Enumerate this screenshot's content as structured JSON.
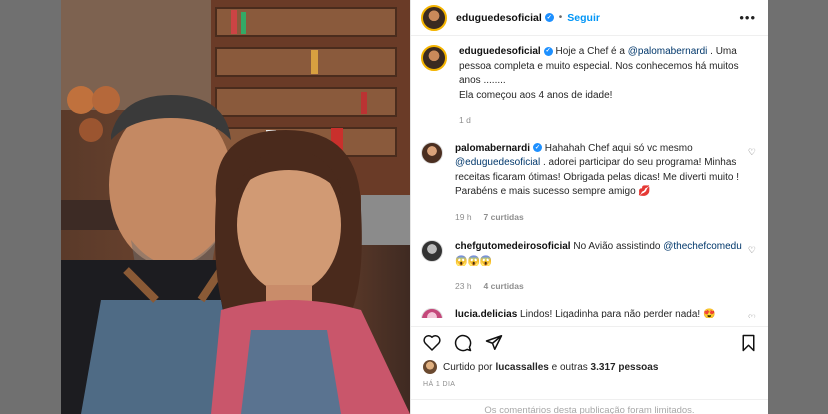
{
  "post": {
    "author": "eduguedesoficial",
    "follow_label": "Seguir",
    "separator": "•",
    "more_label": "•••"
  },
  "caption": {
    "username": "eduguedesoficial",
    "text_before": " Hoje a Chef é a ",
    "mention": "@palomabernardi",
    "text_after": " . Uma pessoa completa e muito especial. Nos conhecemos há muitos anos ........",
    "line2": "Ela começou aos 4 anos de idade!",
    "time": "1 d"
  },
  "comments": [
    {
      "username": "palomabernardi",
      "text_before": " Hahahah Chef aqui só vc mesmo ",
      "mention": "@eduguedesoficial",
      "text_after": " . adorei participar do seu programa! Minhas receitas ficaram ótimas! Obrigada pelas dicas! Me diverti muito ! Parabéns e mais sucesso sempre amigo 💋",
      "time": "19 h",
      "likes": "7 curtidas"
    },
    {
      "username": "chefgutomedeirosoficial",
      "text_before": " No Avião assistindo ",
      "mention": "@thechefcomedu",
      "text_after": " 😱😱😱",
      "time": "23 h",
      "likes": "4 curtidas"
    },
    {
      "username": "lucia.delicias",
      "text_before": " Lindos! Ligadinha para não perder nada! 😍",
      "mention": "",
      "text_after": "",
      "time": "",
      "likes": ""
    }
  ],
  "likes": {
    "prefix": "Curtido por ",
    "user": "lucassalles",
    "suffix": " e outras ",
    "count": "3.317 pessoas"
  },
  "date": "HÁ 1 DIA",
  "footer": "Os comentários desta publicação foram limitados.",
  "icons": {
    "like": "heart-icon",
    "comment": "comment-icon",
    "share": "share-icon",
    "save": "bookmark-icon"
  },
  "colors": {
    "accent": "#0095f6",
    "verified": "#1e90ff",
    "mention": "#00376b"
  }
}
